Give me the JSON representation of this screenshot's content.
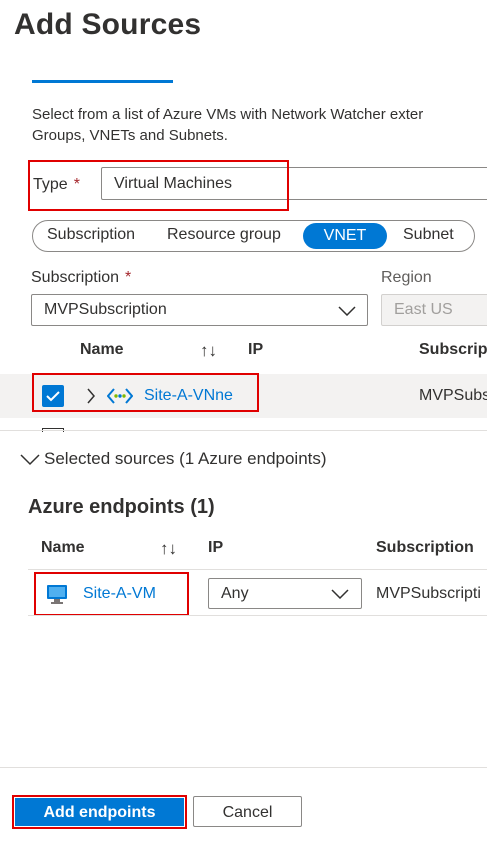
{
  "panel": {
    "title": "Add Sources",
    "description_line1": "Select from a list of Azure VMs with Network Watcher exter",
    "description_line2": "Groups, VNETs and Subnets."
  },
  "type_field": {
    "label": "Type",
    "required_mark": "*",
    "value": "Virtual Machines"
  },
  "filter_tabs": [
    {
      "label": "Subscription",
      "active": false
    },
    {
      "label": "Resource group",
      "active": false
    },
    {
      "label": "VNET",
      "active": true
    },
    {
      "label": "Subnet",
      "active": false
    }
  ],
  "subscription_field": {
    "label": "Subscription",
    "required_mark": "*",
    "value": "MVPSubscription"
  },
  "region_field": {
    "label": "Region",
    "value": "East US"
  },
  "resource_table": {
    "columns": [
      "Name",
      "IP",
      "Subscrip"
    ],
    "sort_icon": "↑↓",
    "rows": [
      {
        "name": "Site-A-VNne",
        "subscription": "MVPSubs",
        "checked": true
      }
    ]
  },
  "selected_sources": {
    "toggle_label": "Selected sources (1 Azure endpoints)"
  },
  "endpoints": {
    "heading": "Azure endpoints (1)",
    "columns": [
      "Name",
      "IP",
      "Subscription"
    ],
    "sort_icon": "↑↓",
    "rows": [
      {
        "name": "Site-A-VM",
        "ip": "Any",
        "subscription": "MVPSubscripti"
      }
    ]
  },
  "footer": {
    "primary_label": "Add endpoints",
    "secondary_label": "Cancel"
  },
  "colors": {
    "accent": "#0078d4",
    "highlight_border": "#e00000",
    "required": "#a4262c"
  }
}
